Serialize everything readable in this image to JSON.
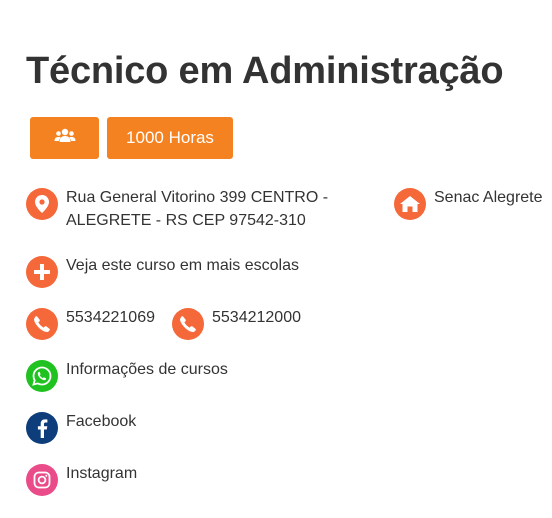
{
  "course": {
    "title": "Técnico em Administração",
    "hours_label": "1000 Horas",
    "group_icon": "group-icon"
  },
  "colors": {
    "accent": "#f58220",
    "icon_orange": "#f4683a",
    "whatsapp": "#1fc21f",
    "facebook": "#0d3d7a",
    "instagram": "#ea4c89",
    "text": "#333333"
  },
  "info": {
    "address_line1": "Rua General Vitorino 399 CENTRO -",
    "address_line2": "ALEGRETE - RS CEP 97542-310",
    "school": "Senac Alegrete",
    "more_schools": "Veja este curso em mais escolas",
    "phone1": "5534221069",
    "phone2": "5534212000",
    "whatsapp": "Informações de cursos",
    "facebook": "Facebook",
    "instagram": "Instagram"
  }
}
